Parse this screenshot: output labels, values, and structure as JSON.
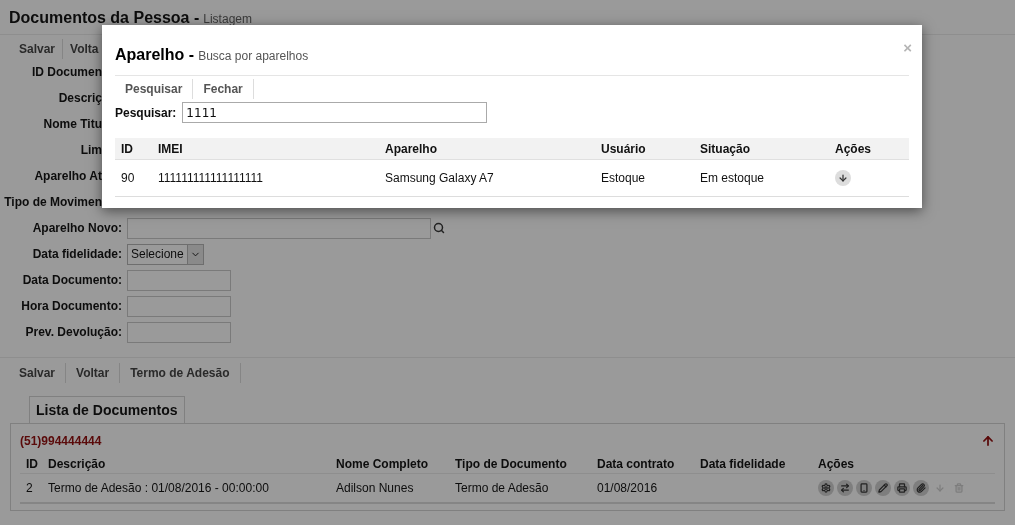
{
  "page": {
    "title": "Documentos da Pessoa -",
    "subtitle": "Listagem"
  },
  "top_toolbar": [
    "Salvar",
    "Volta"
  ],
  "covered_labels": [
    "ID Documen",
    "Descriç",
    "Nome Titu",
    "Lim",
    "Aparelho At",
    "Tipo de Movimen"
  ],
  "form": [
    {
      "kind": "search",
      "label": "Aparelho Novo:"
    },
    {
      "kind": "select",
      "label": "Data fidelidade:",
      "value": "Selecione"
    },
    {
      "kind": "text",
      "label": "Data Documento:"
    },
    {
      "kind": "text",
      "label": "Hora Documento:"
    },
    {
      "kind": "text",
      "label": "Prev. Devolução:"
    }
  ],
  "bottom_toolbar": [
    "Salvar",
    "Voltar",
    "Termo de Adesão"
  ],
  "list_tab": {
    "label": "Lista de Documentos",
    "selected": true
  },
  "list": {
    "phone": "(51)994444444",
    "columns": [
      "ID",
      "Descrição",
      "Nome Completo",
      "Tipo de Documento",
      "Data contrato",
      "Data fidelidade",
      "Ações"
    ],
    "rows": [
      {
        "cells": [
          "2",
          "Termo de Adesão : 01/08/2016 - 00:00:00",
          "Adilson Nunes",
          "Termo de Adesão",
          "01/08/2016",
          ""
        ],
        "actions": [
          {
            "kind": "settings",
            "disabled": false
          },
          {
            "kind": "swap",
            "disabled": false
          },
          {
            "kind": "phone",
            "disabled": false
          },
          {
            "kind": "edit",
            "disabled": false
          },
          {
            "kind": "print",
            "disabled": false
          },
          {
            "kind": "attach",
            "disabled": false
          },
          {
            "kind": "download",
            "disabled": true
          },
          {
            "kind": "delete",
            "disabled": true
          }
        ]
      }
    ]
  },
  "dialog": {
    "title": "Aparelho -",
    "subtitle": "Busca por aparelhos",
    "close": "×",
    "toolbar": [
      "Pesquisar",
      "Fechar"
    ],
    "search": {
      "label": "Pesquisar:",
      "value": "1111"
    },
    "columns": [
      "ID",
      "IMEI",
      "Aparelho",
      "Usuário",
      "Situação",
      "Ações"
    ],
    "rows": [
      {
        "cells": [
          "90",
          "111111111111111111",
          "Samsung Galaxy A7",
          "Estoque",
          "Em estoque"
        ],
        "actions": [
          {
            "kind": "download",
            "disabled": false
          }
        ]
      }
    ]
  }
}
